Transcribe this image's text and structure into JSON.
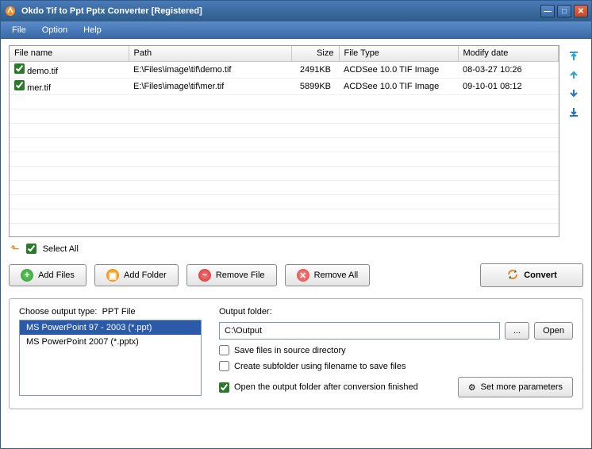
{
  "title": "Okdo Tif to Ppt Pptx Converter [Registered]",
  "menu": {
    "file": "File",
    "option": "Option",
    "help": "Help"
  },
  "columns": {
    "name": "File name",
    "path": "Path",
    "size": "Size",
    "type": "File Type",
    "date": "Modify date"
  },
  "rows": [
    {
      "checked": true,
      "name": "demo.tif",
      "path": "E:\\Files\\image\\tif\\demo.tif",
      "size": "2491KB",
      "type": "ACDSee 10.0 TIF Image",
      "date": "08-03-27 10:26"
    },
    {
      "checked": true,
      "name": "mer.tif",
      "path": "E:\\Files\\image\\tif\\mer.tif",
      "size": "5899KB",
      "type": "ACDSee 10.0 TIF Image",
      "date": "09-10-01 08:12"
    }
  ],
  "selectAll": "Select All",
  "buttons": {
    "addFiles": "Add Files",
    "addFolder": "Add Folder",
    "removeFile": "Remove File",
    "removeAll": "Remove All",
    "convert": "Convert"
  },
  "outputType": {
    "label": "Choose output type:",
    "current": "PPT File",
    "options": [
      {
        "label": "MS PowerPoint 97 - 2003 (*.ppt)",
        "selected": true
      },
      {
        "label": "MS PowerPoint 2007 (*.pptx)",
        "selected": false
      }
    ]
  },
  "outputFolder": {
    "label": "Output folder:",
    "value": "C:\\Output",
    "browse": "...",
    "open": "Open"
  },
  "options": {
    "saveSource": {
      "label": "Save files in source directory",
      "checked": false
    },
    "subfolder": {
      "label": "Create subfolder using filename to save files",
      "checked": false
    },
    "openAfter": {
      "label": "Open the output folder after conversion finished",
      "checked": true
    }
  },
  "moreParams": "Set more parameters",
  "icons": {
    "arrowColors": {
      "top": "#2aa0d8",
      "up": "#2aa0d8",
      "down": "#2a70c8",
      "bottom": "#2a70c8"
    }
  }
}
